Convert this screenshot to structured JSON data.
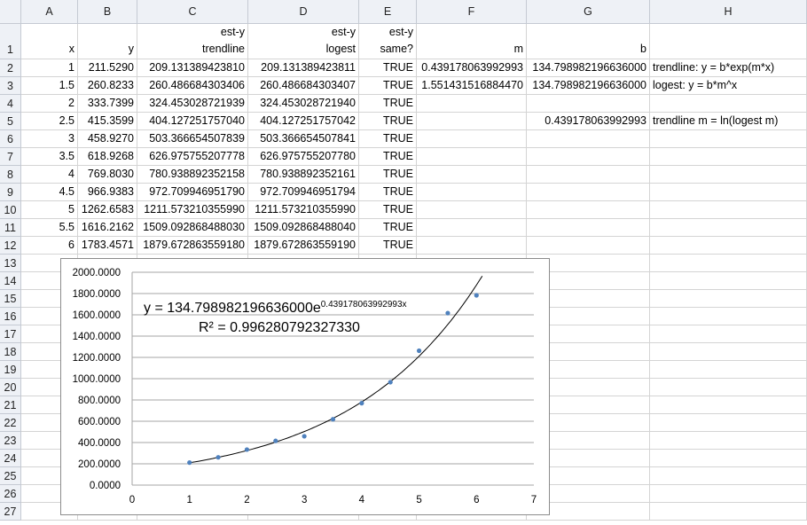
{
  "columns": [
    "A",
    "B",
    "C",
    "D",
    "E",
    "F",
    "G",
    "H"
  ],
  "rows": [
    {
      "num": "1",
      "cells": {
        "A": "x",
        "B": "y",
        "C": "trendline",
        "D": "logest",
        "E": "same?",
        "F": "m",
        "G": "b",
        "H": ""
      }
    },
    {
      "num": "2",
      "cells": {
        "A": "1",
        "B": "211.5290",
        "C": "209.131389423810",
        "D": "209.131389423811",
        "E": "TRUE",
        "F": "0.439178063992993",
        "G": "134.798982196636000",
        "H": "trendline: y = b*exp(m*x)"
      }
    },
    {
      "num": "3",
      "cells": {
        "A": "1.5",
        "B": "260.8233",
        "C": "260.486684303406",
        "D": "260.486684303407",
        "E": "TRUE",
        "F": "1.551431516884470",
        "G": "134.798982196636000",
        "H": "logest: y = b*m^x"
      }
    },
    {
      "num": "4",
      "cells": {
        "A": "2",
        "B": "333.7399",
        "C": "324.453028721939",
        "D": "324.453028721940",
        "E": "TRUE",
        "F": "",
        "G": "",
        "H": ""
      }
    },
    {
      "num": "5",
      "cells": {
        "A": "2.5",
        "B": "415.3599",
        "C": "404.127251757040",
        "D": "404.127251757042",
        "E": "TRUE",
        "F": "",
        "G": "0.439178063992993",
        "H": "trendline m = ln(logest m)"
      }
    },
    {
      "num": "6",
      "cells": {
        "A": "3",
        "B": "458.9270",
        "C": "503.366654507839",
        "D": "503.366654507841",
        "E": "TRUE",
        "F": "",
        "G": "",
        "H": ""
      }
    },
    {
      "num": "7",
      "cells": {
        "A": "3.5",
        "B": "618.9268",
        "C": "626.975755207778",
        "D": "626.975755207780",
        "E": "TRUE",
        "F": "",
        "G": "",
        "H": ""
      }
    },
    {
      "num": "8",
      "cells": {
        "A": "4",
        "B": "769.8030",
        "C": "780.938892352158",
        "D": "780.938892352161",
        "E": "TRUE",
        "F": "",
        "G": "",
        "H": ""
      }
    },
    {
      "num": "9",
      "cells": {
        "A": "4.5",
        "B": "966.9383",
        "C": "972.709946951790",
        "D": "972.709946951794",
        "E": "TRUE",
        "F": "",
        "G": "",
        "H": ""
      }
    },
    {
      "num": "10",
      "cells": {
        "A": "5",
        "B": "1262.6583",
        "C": "1211.573210355990",
        "D": "1211.573210355990",
        "E": "TRUE",
        "F": "",
        "G": "",
        "H": ""
      }
    },
    {
      "num": "11",
      "cells": {
        "A": "5.5",
        "B": "1616.2162",
        "C": "1509.092868488030",
        "D": "1509.092868488040",
        "E": "TRUE",
        "F": "",
        "G": "",
        "H": ""
      }
    },
    {
      "num": "12",
      "cells": {
        "A": "6",
        "B": "1783.4571",
        "C": "1879.672863559180",
        "D": "1879.672863559190",
        "E": "TRUE",
        "F": "",
        "G": "",
        "H": ""
      }
    },
    {
      "num": "13",
      "cells": {}
    },
    {
      "num": "14",
      "cells": {}
    },
    {
      "num": "15",
      "cells": {}
    },
    {
      "num": "16",
      "cells": {}
    },
    {
      "num": "17",
      "cells": {}
    },
    {
      "num": "18",
      "cells": {}
    },
    {
      "num": "19",
      "cells": {}
    },
    {
      "num": "20",
      "cells": {}
    },
    {
      "num": "21",
      "cells": {}
    },
    {
      "num": "22",
      "cells": {}
    },
    {
      "num": "23",
      "cells": {}
    },
    {
      "num": "24",
      "cells": {}
    },
    {
      "num": "25",
      "cells": {}
    },
    {
      "num": "26",
      "cells": {}
    },
    {
      "num": "27",
      "cells": {}
    }
  ],
  "header_line": {
    "C": "est-y",
    "D": "est-y",
    "E": "est-y"
  },
  "chart_data": {
    "type": "scatter",
    "x": [
      1,
      1.5,
      2,
      2.5,
      3,
      3.5,
      4,
      4.5,
      5,
      5.5,
      6
    ],
    "y": [
      211.529,
      260.8233,
      333.7399,
      415.3599,
      458.927,
      618.9268,
      769.803,
      966.9383,
      1262.6583,
      1616.2162,
      1783.4571
    ],
    "xlim": [
      0,
      7
    ],
    "ylim": [
      0,
      2000
    ],
    "xticks": [
      "0",
      "1",
      "2",
      "3",
      "4",
      "5",
      "6",
      "7"
    ],
    "yticks": [
      "0.0000",
      "200.0000",
      "400.0000",
      "600.0000",
      "800.0000",
      "1000.0000",
      "1200.0000",
      "1400.0000",
      "1600.0000",
      "1800.0000",
      "2000.0000"
    ],
    "grid": "horizontal",
    "marker_color": "#4f81bd",
    "trendline": {
      "type": "exponential",
      "b": 134.798982196636,
      "m": 0.439178063992993
    },
    "equation": {
      "prefix": "y = 134.798982196636000e",
      "exponent": "0.439178063992993x"
    },
    "r_squared": "R² = 0.996280792327330"
  }
}
